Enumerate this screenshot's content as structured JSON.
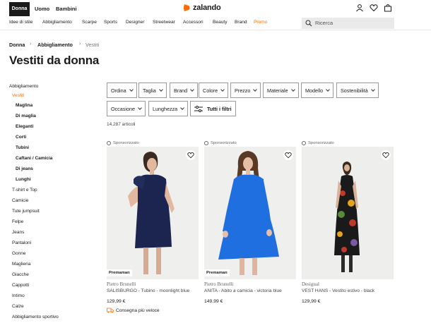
{
  "header": {
    "gender_tabs": [
      "Donna",
      "Uomo",
      "Bambini"
    ],
    "logo": "zalando",
    "brand_color": "#ff6900",
    "icons": [
      "user-icon",
      "heart-icon",
      "bag-icon"
    ]
  },
  "nav": {
    "items": [
      "Idee di stile",
      "Abbigliamento",
      "Scarpe",
      "Sports",
      "Designer",
      "Streetwear",
      "Accessori",
      "Beauty",
      "Brand",
      "Promo"
    ],
    "search_placeholder": "Ricerca"
  },
  "breadcrumb": [
    "Donna",
    "Abbigliamento",
    "Vestiti"
  ],
  "page_title": "Vestiti da donna",
  "sidebar": {
    "top": "Abbigliamento",
    "current": "Vestiti",
    "subcategories": [
      "Maglina",
      "Di maglia",
      "Eleganti",
      "Corti",
      "Tubini",
      "Caftani / Camicia",
      "Di jeans",
      "Lunghi"
    ],
    "categories": [
      "T-shirt e Top",
      "Camicie",
      "Tute jumpsuit",
      "Felpe",
      "Jeans",
      "Pantaloni",
      "Gonne",
      "Maglieria",
      "Giacche",
      "Cappotti",
      "Intimo",
      "Calze",
      "Abbigliamento sportivo"
    ]
  },
  "filters": {
    "row1": [
      "Ordina",
      "Taglia",
      "Brand",
      "Colore",
      "Prezzo",
      "Materiale",
      "Modello",
      "Sostenibilità"
    ],
    "row2": [
      "Occasione",
      "Lunghezza"
    ],
    "all_filters": "Tutti i filtri"
  },
  "article_count": "14.287 articoli",
  "products": [
    {
      "sponsored": "Sponsorizzato",
      "badge": "Premaman",
      "brand": "Pietro Brunelli",
      "name": "SALISBURGO - Tubino - moonlight blue",
      "price": "129,99 €",
      "delivery": "Consegna più veloce",
      "dress_color": "#1b2550"
    },
    {
      "sponsored": "Sponsorizzato",
      "badge": "Premaman",
      "brand": "Pietro Brunelli",
      "name": "ANITA - Abito a camicia - victoria blue",
      "price": "149,99 €",
      "dress_color": "#1f6fe0"
    },
    {
      "sponsored": "Sponsorizzato",
      "brand": "Desigual",
      "name": "VEST HANS - Vestito estivo - black",
      "price": "129,99 €",
      "dress_color": "#1a1a1a"
    }
  ]
}
